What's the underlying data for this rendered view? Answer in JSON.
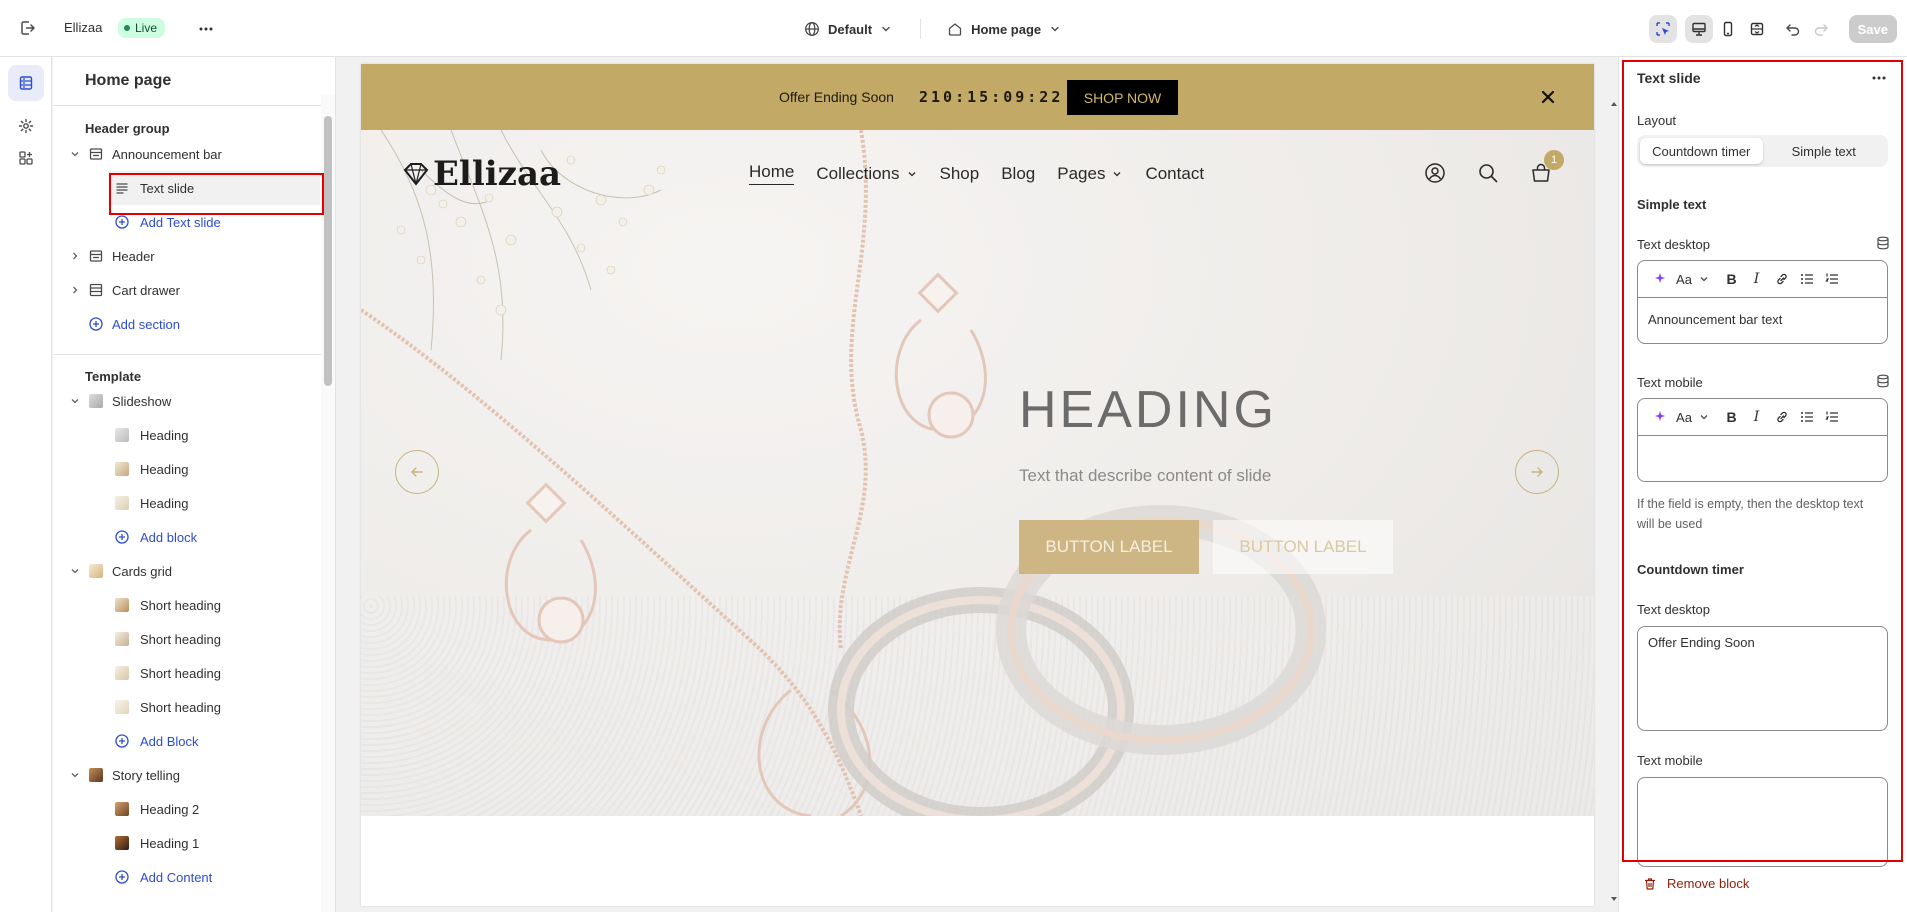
{
  "topbar": {
    "store_name": "Ellizaa",
    "status_badge": "Live",
    "theme_selector": "Default",
    "page_selector": "Home page",
    "save_label": "Save"
  },
  "sidebar": {
    "title": "Home page",
    "header_group": {
      "label": "Header group",
      "items": [
        {
          "label": "Announcement bar"
        },
        {
          "label": "Text slide"
        },
        {
          "label": "Add Text slide"
        },
        {
          "label": "Header"
        },
        {
          "label": "Cart drawer"
        },
        {
          "label": "Add section"
        }
      ]
    },
    "template": {
      "label": "Template",
      "items": [
        {
          "label": "Slideshow"
        },
        {
          "label": "Heading"
        },
        {
          "label": "Heading"
        },
        {
          "label": "Heading"
        },
        {
          "label": "Add block"
        },
        {
          "label": "Cards grid"
        },
        {
          "label": "Short heading"
        },
        {
          "label": "Short heading"
        },
        {
          "label": "Short heading"
        },
        {
          "label": "Short heading"
        },
        {
          "label": "Add Block"
        },
        {
          "label": "Story telling"
        },
        {
          "label": "Heading 2"
        },
        {
          "label": "Heading 1"
        },
        {
          "label": "Add Content"
        }
      ]
    }
  },
  "preview": {
    "announcement": {
      "text": "Offer Ending Soon",
      "timer": "210:15:09:22",
      "button": "SHOP NOW",
      "background": "#c2a965"
    },
    "header": {
      "logo": "Ellizaa",
      "nav": [
        "Home",
        "Collections",
        "Shop",
        "Blog",
        "Pages",
        "Contact"
      ],
      "cart_count": "1"
    },
    "hero": {
      "heading": "HEADING",
      "subtext": "Text that describe content of slide",
      "button1": "BUTTON LABEL",
      "button2": "BUTTON LABEL"
    }
  },
  "settings": {
    "title": "Text slide",
    "layout_label": "Layout",
    "layout_options": [
      "Countdown timer",
      "Simple text"
    ],
    "layout_selected": "Countdown timer",
    "simple_text": {
      "heading": "Simple text",
      "desktop_label": "Text desktop",
      "desktop_value": "Announcement bar text",
      "mobile_label": "Text mobile",
      "mobile_value": "",
      "help": "If the field is empty, then the desktop text will be used"
    },
    "countdown": {
      "heading": "Countdown timer",
      "desktop_label": "Text desktop",
      "desktop_value": "Offer Ending Soon",
      "mobile_label": "Text mobile",
      "mobile_value": ""
    },
    "remove_label": "Remove block"
  },
  "colors": {
    "accent_blue": "#2c4dd1",
    "highlight_red": "#e30000",
    "live_green": "#29845a",
    "gold": "#c2a965"
  }
}
